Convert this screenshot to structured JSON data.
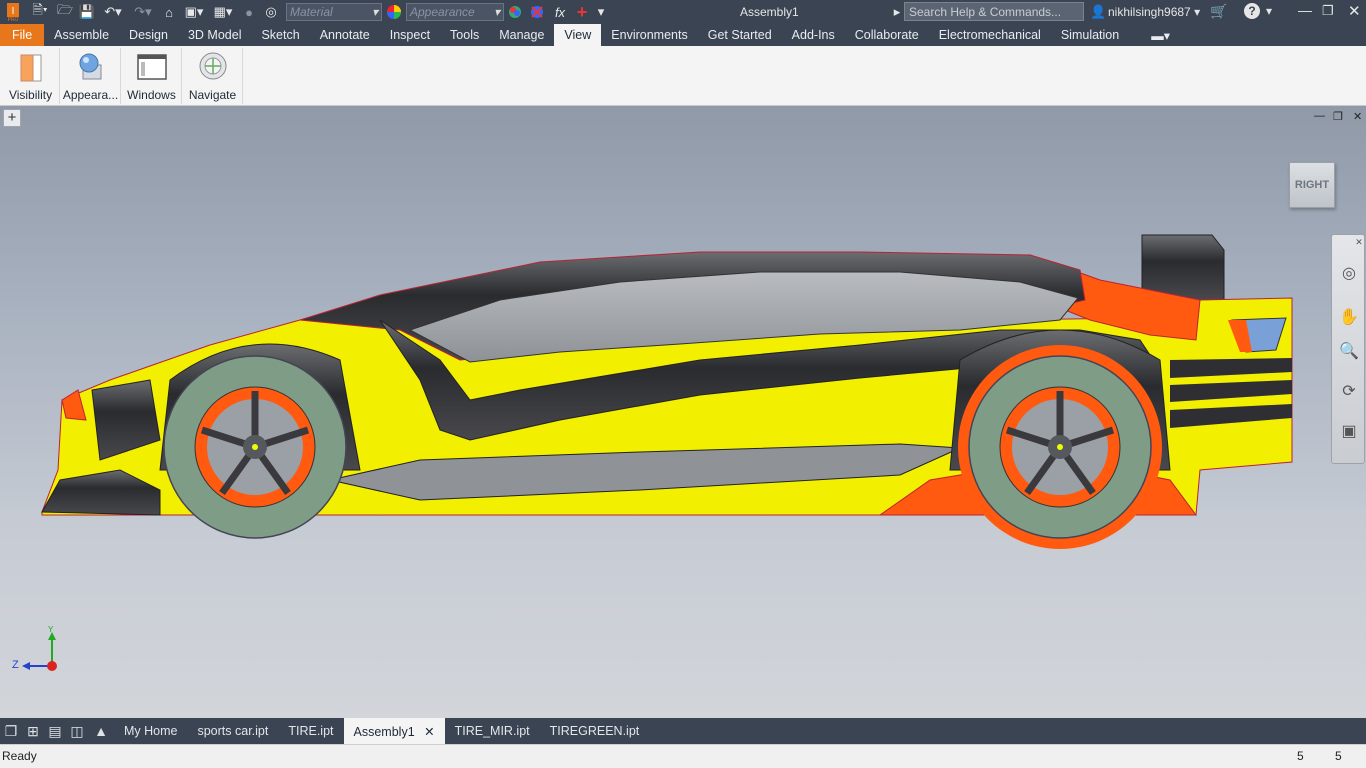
{
  "app": {
    "title": "Assembly1"
  },
  "qat": {
    "material_placeholder": "Material",
    "appearance_placeholder": "Appearance",
    "search_placeholder": "Search Help & Commands...",
    "user": "nikhilsingh9687",
    "fx_label": "fx"
  },
  "tabs": [
    "File",
    "Assemble",
    "Design",
    "3D Model",
    "Sketch",
    "Annotate",
    "Inspect",
    "Tools",
    "Manage",
    "View",
    "Environments",
    "Get Started",
    "Add-Ins",
    "Collaborate",
    "Electromechanical",
    "Simulation"
  ],
  "active_tab": "View",
  "ribbon": {
    "visibility": "Visibility",
    "appearance": "Appeara...",
    "windows": "Windows",
    "navigate": "Navigate"
  },
  "viewcube": {
    "face": "RIGHT"
  },
  "triad": {
    "z": "Z",
    "y": "Y"
  },
  "doc_tabs": [
    "My Home",
    "sports car.ipt",
    "TIRE.ipt",
    "Assembly1",
    "TIRE_MIR.ipt",
    "TIREGREEN.ipt"
  ],
  "active_doc": "Assembly1",
  "status": {
    "text": "Ready",
    "count1": "5",
    "count2": "5"
  },
  "colors": {
    "accent": "#e8761a",
    "chrome": "#3b4453",
    "body_yellow": "#f2ef00",
    "body_orange": "#ff5a10",
    "tire_green": "#7f9d86",
    "carbon": "#2f2f33"
  }
}
